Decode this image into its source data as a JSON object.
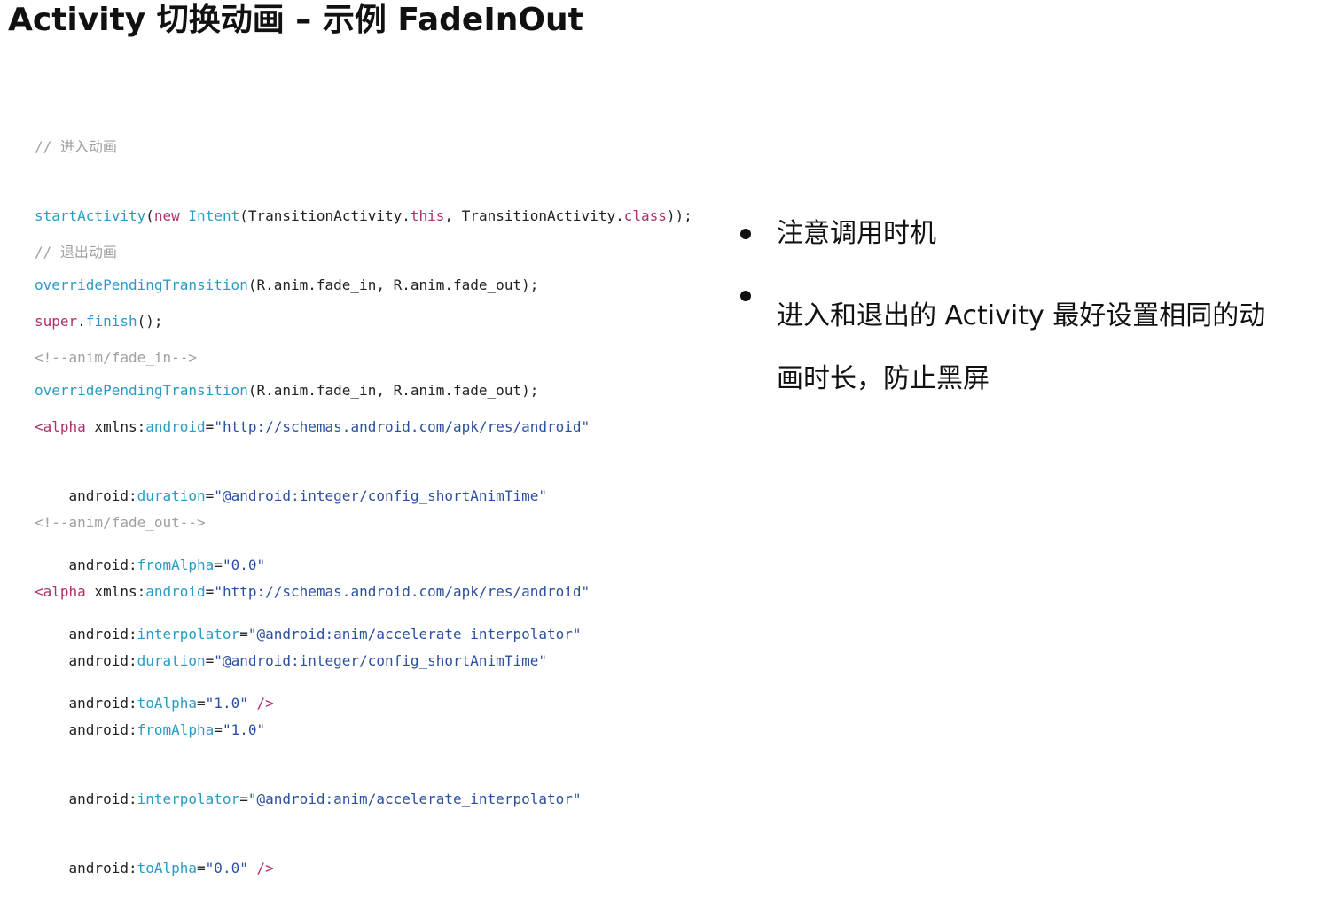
{
  "title": "Activity 切换动画 – 示例 FadeInOut",
  "code_blocks": {
    "enter": {
      "comment": "// 进入动画",
      "line1": {
        "method": "startActivity",
        "p1": "(",
        "kw_new": "new",
        "space": " ",
        "intent": "Intent",
        "p2": "(",
        "cls1": "TransitionActivity.",
        "kw_this": "this",
        "mid": ", TransitionActivity.",
        "kw_class": "class",
        "end": "));"
      },
      "line2": {
        "method": "overridePendingTransition",
        "args": "(R.anim.fade_in, R.anim.fade_out);"
      }
    },
    "exit": {
      "comment": "// 退出动画",
      "line1": {
        "kw_super": "super",
        "dot": ".",
        "method": "finish",
        "end": "();"
      },
      "line2": {
        "method": "overridePendingTransition",
        "args": "(R.anim.fade_in, R.anim.fade_out);"
      }
    },
    "fade_in": {
      "comment": "<!--anim/fade_in-->",
      "tag_open": "<alpha",
      "xmlns_key": " xmlns:",
      "xmlns_attr": "android",
      "xmlns_eq": "=",
      "xmlns_val": "\"http://schemas.android.com/apk/res/android\"",
      "attrs": [
        {
          "ns": "    android:",
          "name": "duration",
          "eq": "=",
          "value": "\"@android:integer/config_shortAnimTime\""
        },
        {
          "ns": "    android:",
          "name": "fromAlpha",
          "eq": "=",
          "value": "\"0.0\""
        },
        {
          "ns": "    android:",
          "name": "interpolator",
          "eq": "=",
          "value": "\"@android:anim/accelerate_interpolator\""
        },
        {
          "ns": "    android:",
          "name": "toAlpha",
          "eq": "=",
          "value": "\"1.0\"",
          "close": " />"
        }
      ]
    },
    "fade_out": {
      "comment": "<!--anim/fade_out-->",
      "tag_open": "<alpha",
      "xmlns_key": " xmlns:",
      "xmlns_attr": "android",
      "xmlns_eq": "=",
      "xmlns_val": "\"http://schemas.android.com/apk/res/android\"",
      "attrs": [
        {
          "ns": "    android:",
          "name": "duration",
          "eq": "=",
          "value": "\"@android:integer/config_shortAnimTime\""
        },
        {
          "ns": "    android:",
          "name": "fromAlpha",
          "eq": "=",
          "value": "\"1.0\""
        },
        {
          "ns": "    android:",
          "name": "interpolator",
          "eq": "=",
          "value": "\"@android:anim/accelerate_interpolator\""
        },
        {
          "ns": "    android:",
          "name": "toAlpha",
          "eq": "=",
          "value": "\"0.0\"",
          "close": " />"
        }
      ]
    }
  },
  "bullets": [
    {
      "text": "注意调用时机"
    },
    {
      "text_line1": "进入和退出的 Activity 最好设置相同的动",
      "text_line2": "画时长，防止黑屏"
    }
  ]
}
